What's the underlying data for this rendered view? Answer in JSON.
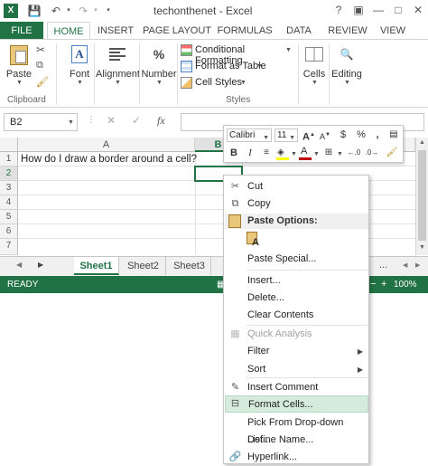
{
  "window": {
    "title": "techonthenet - Excel",
    "controls": {
      "help": "?",
      "restore": "▣",
      "minimize": "—",
      "maximize": "□",
      "close": "✕"
    }
  },
  "ribbon_tabs": [
    "FILE",
    "HOME",
    "INSERT",
    "PAGE LAYOUT",
    "FORMULAS",
    "DATA",
    "REVIEW",
    "VIEW"
  ],
  "ribbon": {
    "clipboard": {
      "paste": "Paste",
      "group": "Clipboard"
    },
    "font": "Font",
    "alignment": "Alignment",
    "number": "Number",
    "styles": {
      "conditional": "Conditional Formatting",
      "format_table": "Format as Table",
      "cell_styles": "Cell Styles",
      "group": "Styles"
    },
    "cells": "Cells",
    "editing": "Editing"
  },
  "formula_bar": {
    "name_box": "B2",
    "fx": "fx",
    "cancel": "✕",
    "enter": "✓"
  },
  "grid": {
    "columns": [
      "A",
      "B"
    ],
    "rows": [
      "1",
      "2",
      "3",
      "4",
      "5",
      "6",
      "7"
    ],
    "a1": "How do I draw a border around a cell?"
  },
  "sheets": {
    "tabs": [
      "Sheet1",
      "Sheet2",
      "Sheet3"
    ],
    "active": "Sheet1",
    "add": "..."
  },
  "status": {
    "ready": "READY",
    "zoom": "100%"
  },
  "mini_toolbar": {
    "font": "Calibri",
    "size": "11",
    "bold": "B",
    "italic": "I",
    "percent": "%",
    "comma": ",",
    "currency": "$"
  },
  "context_menu": {
    "cut": "Cut",
    "copy": "Copy",
    "paste_options": "Paste Options:",
    "paste_special": "Paste Special...",
    "insert": "Insert...",
    "delete": "Delete...",
    "clear_contents": "Clear Contents",
    "quick_analysis": "Quick Analysis",
    "filter": "Filter",
    "sort": "Sort",
    "insert_comment": "Insert Comment",
    "format_cells": "Format Cells...",
    "pick_list": "Pick From Drop-down List...",
    "define_name": "Define Name...",
    "hyperlink": "Hyperlink..."
  },
  "colors": {
    "brand": "#217346",
    "highlight": "#d5ebdc",
    "font_color": "#c00000",
    "fill_color": "#ffff00"
  }
}
